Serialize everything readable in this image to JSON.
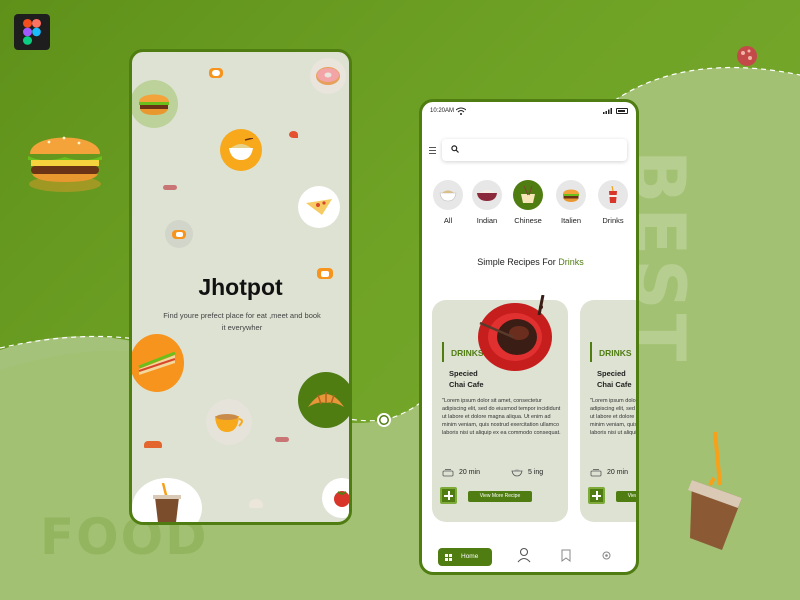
{
  "background_words": {
    "left": "FOOD",
    "right": "BEST"
  },
  "splash": {
    "brand": "Jhotpot",
    "tagline": "Find youre prefect place for eat ,meet and book it everywher"
  },
  "status_bar": {
    "time": "10:20AM"
  },
  "search": {
    "placeholder": ""
  },
  "categories": [
    {
      "label": "All",
      "icon": "noodle-bowl-icon"
    },
    {
      "label": "Indian",
      "icon": "rice-bowl-icon"
    },
    {
      "label": "Chinese",
      "icon": "chinese-food-icon",
      "active": true
    },
    {
      "label": "Italien",
      "icon": "burger-icon"
    },
    {
      "label": "Drinks",
      "icon": "drink-icon"
    }
  ],
  "section": {
    "prefix": "Simple Recipes For",
    "accent": "Drinks"
  },
  "cards": [
    {
      "tag": "DRINKS",
      "name_line1": "Specied",
      "name_line2": "Chai Cafe",
      "desc": "\"Lorem ipsum dolor sit amet, consectetur adipiscing elit, sed do eiusmod tempor incididunt ut labore et dolore magna aliqua. Ut enim ad minim veniam, quis nostrud exercitation ullamco laboris nisi ut aliquip ex ea commodo consequat.",
      "time": "20 min",
      "ingredients": "5 ing",
      "button": "View More Recipe"
    },
    {
      "tag": "DRINKS",
      "name_line1": "Specied",
      "name_line2": "Chai Cafe",
      "desc": "\"Lorem ipsum dolor sit amet, consectetur adipiscing elit, sed do eiusmod tempor incididunt ut labore et dolore magna aliqua. Ut enim ad minim veniam, quis nostrud exercitation ullamco laboris nisi ut aliquip ex ea commodo consequat.",
      "time": "20 min",
      "button": "View More Recipe"
    }
  ],
  "bottom_nav": {
    "home": "Home"
  },
  "colors": {
    "brand_green": "#4f7d12",
    "card_bg": "#dde2d3",
    "orange": "#f7941d"
  }
}
